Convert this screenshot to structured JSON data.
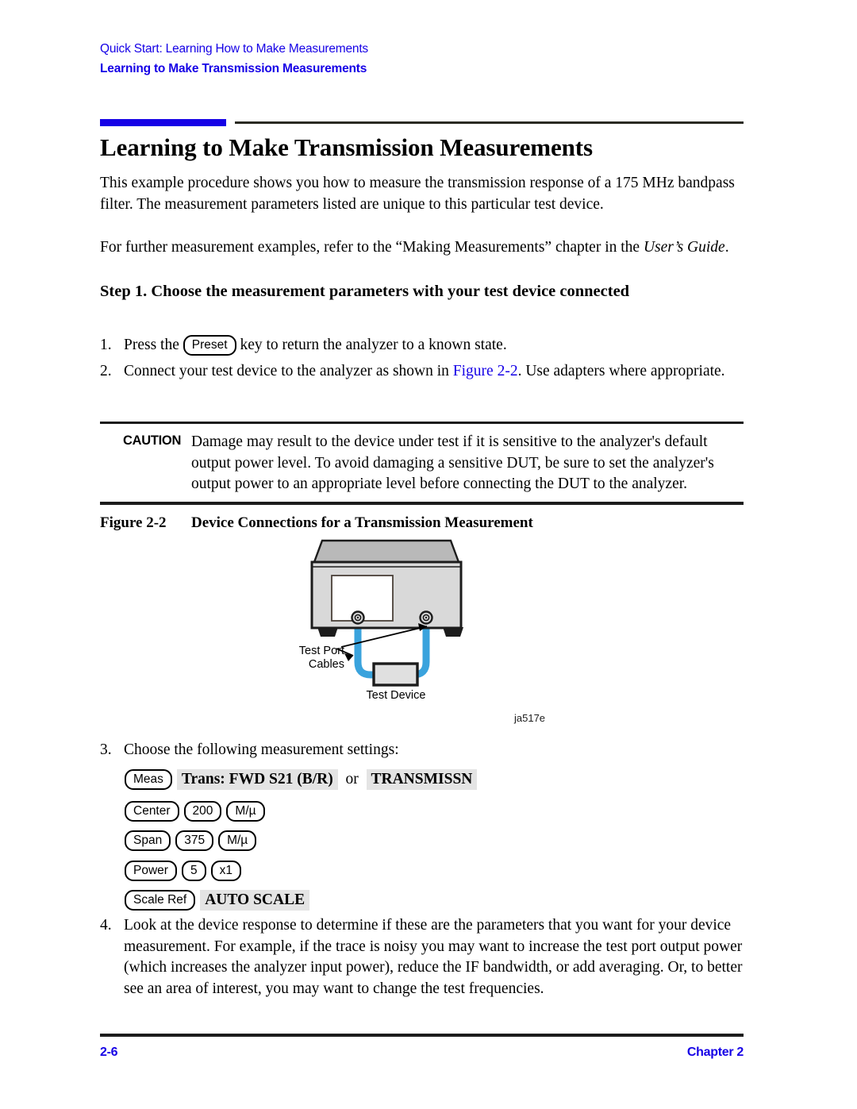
{
  "header": {
    "running_title": "Quick Start: Learning How to Make Measurements",
    "section_title": "Learning to Make Transmission Measurements"
  },
  "title": "Learning to Make Transmission Measurements",
  "intro": {
    "paragraph_1": "This example procedure shows you how to measure the transmission response of a 175 MHz bandpass filter. The measurement parameters listed are unique to this particular test device.",
    "paragraph_2_before": "For further measurement examples, refer to the “Making Measurements” chapter in the ",
    "paragraph_2_italic": "User’s Guide",
    "paragraph_2_after": "."
  },
  "step_heading": "Step 1. Choose the measurement parameters with your test device connected",
  "list": {
    "item1": {
      "number": "1.",
      "text_before": "Press the ",
      "key": "Preset",
      "text_after": " key to return the analyzer to a known state."
    },
    "item2": {
      "number": "2.",
      "text_before": "Connect your test device to the analyzer as shown in ",
      "link": "Figure 2-2",
      "text_after": ". Use adapters where appropriate."
    },
    "item3": {
      "number": "3.",
      "text": "Choose the following measurement settings:"
    },
    "item4": {
      "number": "4.",
      "text": "Look at the device response to determine if these are the parameters that you want for your device measurement. For example, if the trace is noisy you may want to increase the test port output power (which increases the analyzer input power), reduce the IF bandwidth, or add averaging. Or, to better see an area of interest, you may want to change the test frequencies."
    }
  },
  "caution": {
    "label": "CAUTION",
    "text": "Damage may result to the device under test if it is sensitive to the analyzer's default output power level. To avoid damaging a sensitive DUT, be sure to set the analyzer's output power to an appropriate level before connecting the DUT to the analyzer."
  },
  "figure": {
    "caption_number": "Figure 2-2",
    "caption_title": "Device Connections for a Transmission Measurement",
    "label_test_port": "Test Port",
    "label_cables": "Cables",
    "label_test_device": "Test Device",
    "art_id": "ja517e"
  },
  "key_sequences": [
    {
      "hardkeys": [
        "Meas"
      ],
      "softkey_1": "Trans: FWD S21 (B/R)",
      "connector": "or",
      "softkey_2": "TRANSMISSN"
    },
    {
      "hardkeys": [
        "Center",
        "200",
        "M/µ"
      ]
    },
    {
      "hardkeys": [
        "Span",
        "375",
        "M/µ"
      ]
    },
    {
      "hardkeys": [
        "Power",
        "5",
        "x1"
      ]
    },
    {
      "hardkeys": [
        "Scale Ref"
      ],
      "softkey_1": "AUTO SCALE"
    }
  ],
  "footer": {
    "page_number": "2-6",
    "chapter": "Chapter 2"
  },
  "colors": {
    "accent_blue": "#1500e6",
    "cable_blue": "#3aa3dd",
    "instrument_body": "#d9d9d9",
    "instrument_top": "#b9b9b9",
    "softkey_background": "#e4e4e4"
  }
}
